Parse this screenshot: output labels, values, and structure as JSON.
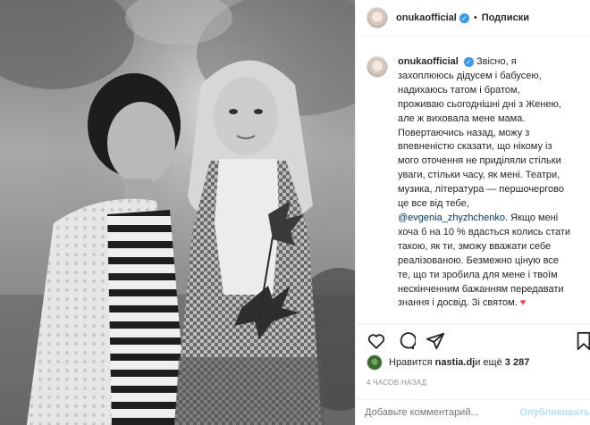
{
  "header": {
    "username": "onukaofficial",
    "follow_label": "Подписки",
    "separator": "•"
  },
  "caption": {
    "username": "onukaofficial",
    "lines": [
      "Звісно, я",
      "захоплююсь дідусем і бабусею,",
      "надихаюсь татом і братом,",
      "проживаю сьогоднішні дні з Женею,",
      "але ж виховала мене мама.",
      "Повертаючись назад, можу з",
      "впевненістю сказати, що нікому із",
      "мого оточення не приділяли стільки",
      "уваги, стільки часу, як мені. Театри,",
      "музика, література — першочергово",
      "це все від тебе,"
    ],
    "mention": "@evgenia_zhyzhchenko",
    "lines_after": [
      ". Якщо мені",
      "хоча б на 10 % вдасться колись стати",
      "такою, як ти, зможу вважати себе",
      "реалізованою. Безмежно ціную все",
      "те, що ти зробила для мене і твоїм",
      "нескінченним бажанням передавати",
      "знання і досвід. Зі святом."
    ],
    "heart": "♥",
    "more": "— …"
  },
  "actions": {
    "like": "heart-outline-icon",
    "comment": "comment-icon",
    "share": "share-icon",
    "save": "bookmark-icon"
  },
  "likes": {
    "prefix": "Нравится ",
    "user": "nastia.dj",
    "middle": " и ещё ",
    "count": "3 287"
  },
  "time": "4 ЧАСОВ НАЗАД",
  "comment": {
    "placeholder": "Добавьте комментарий...",
    "publish": "Опубликовать"
  },
  "colors": {
    "accent": "#3897f0",
    "mention": "#00376b",
    "heart": "#ed4956",
    "muted": "#8e8e8e",
    "publish_disabled": "#b2dffc"
  }
}
